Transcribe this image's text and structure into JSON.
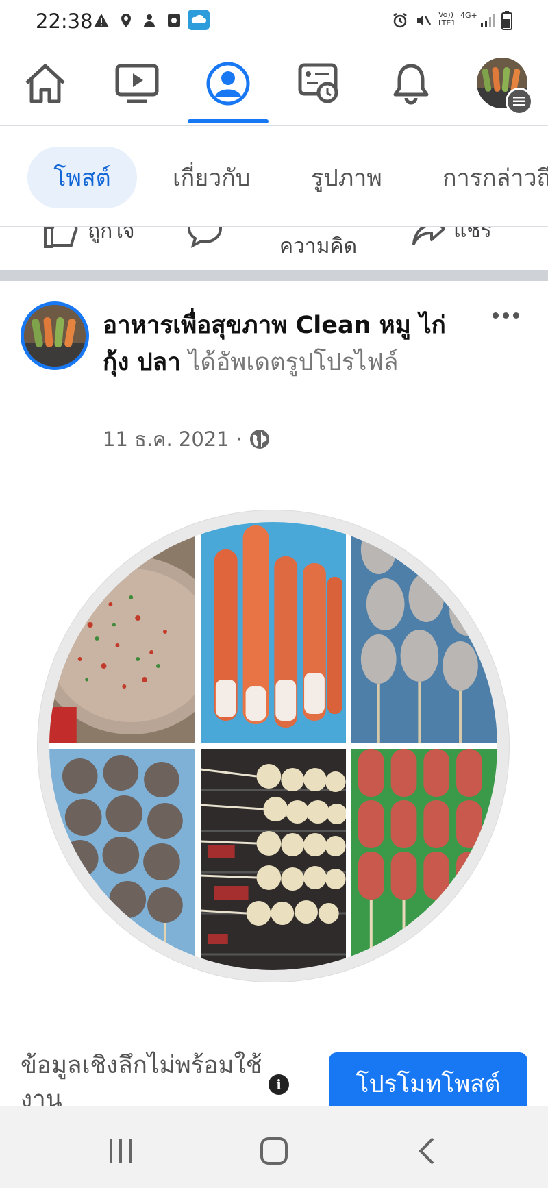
{
  "status_bar": {
    "time": "22:38",
    "network_top": "Vo))",
    "network_bottom": "LTE1",
    "signal_label": "4G+"
  },
  "nav": {
    "items": [
      "home-icon",
      "video-icon",
      "profile-icon",
      "pages-icon",
      "notifications-icon",
      "menu-avatar"
    ],
    "active": "profile-icon",
    "accent_color": "#1877f2"
  },
  "tabs": [
    {
      "label": "โพสต์",
      "active": true
    },
    {
      "label": "เกี่ยวกับ",
      "active": false
    },
    {
      "label": "รูปภาพ",
      "active": false
    },
    {
      "label": "การกล่าวถึง",
      "active": false
    }
  ],
  "actions": {
    "like": "ถูกใจ",
    "comment": "ความคิดเห็น",
    "share": "แชร์"
  },
  "post": {
    "page_name": "อาหารเพื่อสุขภาพ Clean หมู ไก่ กุ้ง ปลา",
    "action_text": "ได้อัพเดตรูปโปรไฟล์",
    "date": "11 ธ.ค. 2021",
    "separator": "·",
    "privacy_icon": "globe-icon"
  },
  "insights": {
    "text": "ข้อมูลเชิงลึกไม่พร้อมใช้งาน",
    "info_icon": "i"
  },
  "promote": {
    "label": "โปรโมทโพสต์"
  }
}
